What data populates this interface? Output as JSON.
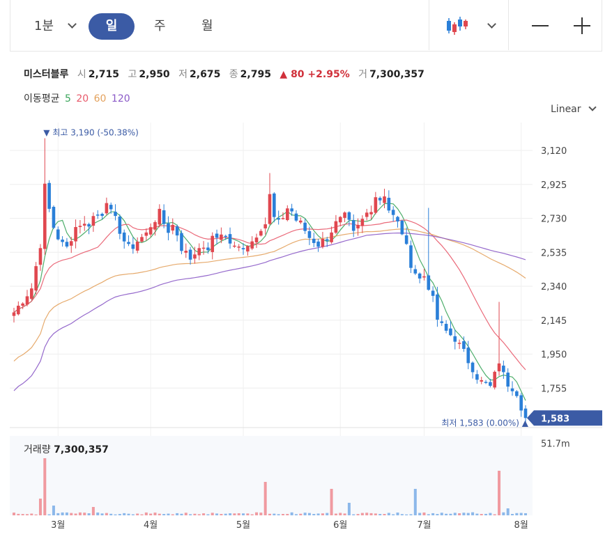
{
  "toolbar": {
    "interval_minute": "1분",
    "tab_day": "일",
    "tab_week": "주",
    "tab_month": "월",
    "chart_type_icon": "candlestick-icon",
    "zoom_out_icon": "minus-icon",
    "zoom_in_icon": "plus-icon"
  },
  "info": {
    "name": "미스터블루",
    "open_label": "시",
    "open": "2,715",
    "high_label": "고",
    "high": "2,950",
    "low_label": "저",
    "low": "2,675",
    "close_label": "종",
    "close": "2,795",
    "change": "▲ 80 +2.95%",
    "volume_label": "거",
    "volume": "7,300,357"
  },
  "moving_average": {
    "label": "이동평균",
    "periods": [
      {
        "text": "5",
        "color": "#3aa55b"
      },
      {
        "text": "20",
        "color": "#e8596a"
      },
      {
        "text": "60",
        "color": "#e3a15c"
      },
      {
        "text": "120",
        "color": "#8a59c7"
      }
    ]
  },
  "scale_menu": "Linear",
  "volume_panel": {
    "label": "거래량",
    "value": "7,300,357",
    "axis_tick": "51.7m"
  },
  "colors": {
    "up": "#e0474f",
    "down": "#2a7fd8",
    "accent": "#3b5ba5"
  },
  "chart_data": {
    "type": "candlestick",
    "y_axis": {
      "min": 1560,
      "max": 3280,
      "ticks": [
        3120,
        2925,
        2730,
        2535,
        2340,
        2145,
        1950,
        1755
      ]
    },
    "y_tick_labels": [
      "3,120",
      "2,925",
      "2,730",
      "2,535",
      "2,340",
      "2,145",
      "1,950",
      "1,755"
    ],
    "x_labels": [
      {
        "label": "3월",
        "index": 10
      },
      {
        "label": "4월",
        "index": 31
      },
      {
        "label": "5월",
        "index": 52
      },
      {
        "label": "6월",
        "index": 74
      },
      {
        "label": "7월",
        "index": 93
      },
      {
        "label": "8월",
        "index": 115
      }
    ],
    "max_marker": {
      "text": "▼ 최고 3,190 (-50.38%)",
      "index": 7,
      "value": 3190
    },
    "min_marker": {
      "text": "최저 1,583 (0.00%) ▲",
      "index": 116,
      "value": 1583
    },
    "last_price": {
      "text": "1,583",
      "value": 1583
    },
    "anchors": [
      [
        0,
        2190
      ],
      [
        2,
        2260
      ],
      [
        4,
        2330
      ],
      [
        6,
        2580
      ],
      [
        7,
        2910
      ],
      [
        8,
        2780
      ],
      [
        9,
        2680
      ],
      [
        10,
        2620
      ],
      [
        11,
        2580
      ],
      [
        12,
        2560
      ],
      [
        13,
        2620
      ],
      [
        14,
        2680
      ],
      [
        15,
        2700
      ],
      [
        16,
        2690
      ],
      [
        17,
        2700
      ],
      [
        18,
        2740
      ],
      [
        19,
        2750
      ],
      [
        20,
        2760
      ],
      [
        21,
        2840
      ],
      [
        22,
        2760
      ],
      [
        23,
        2720
      ],
      [
        24,
        2660
      ],
      [
        25,
        2600
      ],
      [
        26,
        2560
      ],
      [
        27,
        2570
      ],
      [
        28,
        2600
      ],
      [
        30,
        2640
      ],
      [
        31,
        2690
      ],
      [
        33,
        2760
      ],
      [
        34,
        2700
      ],
      [
        35,
        2660
      ],
      [
        36,
        2690
      ],
      [
        37,
        2640
      ],
      [
        38,
        2560
      ],
      [
        40,
        2500
      ],
      [
        41,
        2530
      ],
      [
        42,
        2580
      ],
      [
        43,
        2540
      ],
      [
        44,
        2560
      ],
      [
        45,
        2610
      ],
      [
        46,
        2620
      ],
      [
        47,
        2650
      ],
      [
        48,
        2620
      ],
      [
        49,
        2590
      ],
      [
        50,
        2560
      ],
      [
        51,
        2560
      ],
      [
        52,
        2570
      ],
      [
        54,
        2600
      ],
      [
        55,
        2640
      ],
      [
        56,
        2680
      ],
      [
        57,
        2700
      ],
      [
        58,
        2860
      ],
      [
        59,
        2730
      ],
      [
        60,
        2700
      ],
      [
        61,
        2740
      ],
      [
        62,
        2790
      ],
      [
        63,
        2770
      ],
      [
        64,
        2720
      ],
      [
        65,
        2700
      ],
      [
        66,
        2660
      ],
      [
        67,
        2620
      ],
      [
        68,
        2600
      ],
      [
        69,
        2580
      ],
      [
        70,
        2600
      ],
      [
        71,
        2620
      ],
      [
        72,
        2660
      ],
      [
        73,
        2700
      ],
      [
        74,
        2720
      ],
      [
        75,
        2740
      ],
      [
        76,
        2700
      ],
      [
        77,
        2640
      ],
      [
        78,
        2680
      ],
      [
        79,
        2720
      ],
      [
        80,
        2760
      ],
      [
        81,
        2790
      ],
      [
        82,
        2860
      ],
      [
        83,
        2840
      ],
      [
        84,
        2870
      ],
      [
        85,
        2780
      ],
      [
        86,
        2740
      ],
      [
        87,
        2700
      ],
      [
        88,
        2650
      ],
      [
        89,
        2560
      ],
      [
        90,
        2470
      ],
      [
        91,
        2420
      ],
      [
        92,
        2380
      ],
      [
        93,
        2400
      ],
      [
        94,
        2340
      ],
      [
        95,
        2260
      ],
      [
        96,
        2150
      ],
      [
        97,
        2110
      ],
      [
        98,
        2080
      ],
      [
        99,
        2060
      ],
      [
        100,
        2040
      ],
      [
        101,
        2000
      ],
      [
        102,
        1960
      ],
      [
        103,
        1910
      ],
      [
        104,
        1870
      ],
      [
        105,
        1820
      ],
      [
        106,
        1790
      ],
      [
        107,
        1780
      ],
      [
        108,
        1760
      ],
      [
        109,
        1830
      ],
      [
        110,
        1910
      ],
      [
        111,
        1830
      ],
      [
        112,
        1780
      ],
      [
        113,
        1760
      ],
      [
        114,
        1730
      ],
      [
        115,
        1650
      ],
      [
        116,
        1583
      ]
    ],
    "volume_spikes": [
      {
        "index": 7,
        "value": 41
      },
      {
        "index": 6,
        "value": 12
      },
      {
        "index": 9,
        "value": 7
      },
      {
        "index": 18,
        "value": 6
      },
      {
        "index": 57,
        "value": 24
      },
      {
        "index": 72,
        "value": 19
      },
      {
        "index": 76,
        "value": 9
      },
      {
        "index": 91,
        "value": 19
      },
      {
        "index": 110,
        "value": 32
      },
      {
        "index": 112,
        "value": 5
      }
    ],
    "volume_axis": {
      "max": 55,
      "tick": 51.7
    }
  }
}
